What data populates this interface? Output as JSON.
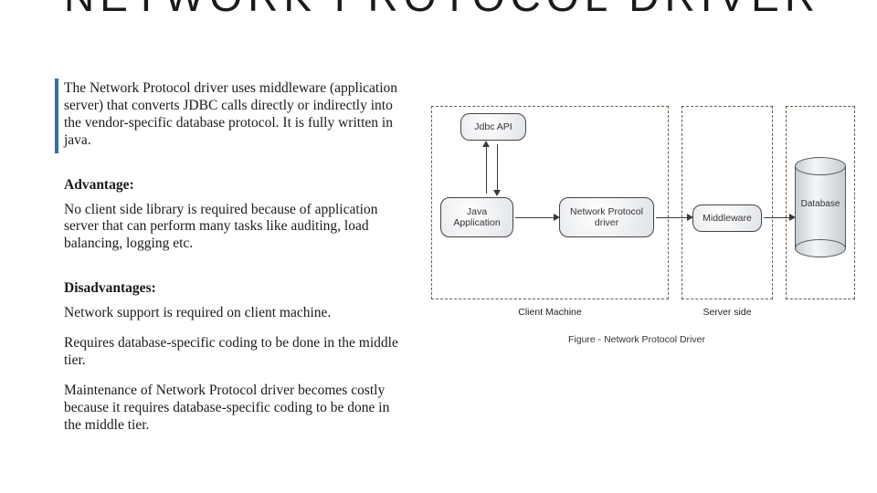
{
  "heading": "NETWORK PROTOCOL DRIVER",
  "intro": "The Network Protocol driver uses middleware (application server) that converts JDBC calls directly or indirectly into the vendor-specific database protocol. It is fully written in java.",
  "advantage_label": "Advantage:",
  "advantage_text": "No client side library is required because of application server that can perform many tasks like auditing, load balancing, logging etc.",
  "disadvantage_label": "Disadvantages:",
  "disadvantages": [
    "Network support is required on client machine.",
    "Requires database-specific coding to be done in the middle tier.",
    "Maintenance of Network Protocol driver becomes costly because it requires database-specific coding to be done in the middle tier."
  ],
  "diagram": {
    "jdbc_api": "Jdbc API",
    "java_app": "Java Application",
    "npd": "Network Protocol driver",
    "middleware": "Middleware",
    "database": "Database",
    "client_label": "Client Machine",
    "server_label": "Server side",
    "caption": "Figure - Network Protocol Driver"
  }
}
